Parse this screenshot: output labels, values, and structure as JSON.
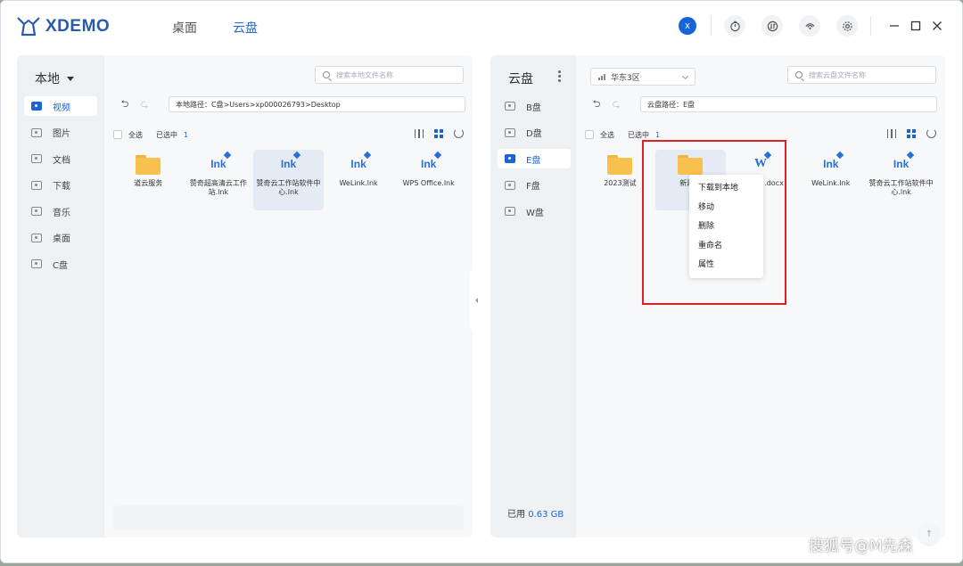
{
  "app": {
    "logo_text": "XDEMO"
  },
  "nav": {
    "tabs": [
      {
        "label": "桌面"
      },
      {
        "label": "云盘"
      }
    ],
    "active": 1
  },
  "titlebar": {
    "avatar_letter": "x"
  },
  "left": {
    "title": "本地",
    "sidebar": [
      {
        "label": "视频",
        "active": true
      },
      {
        "label": "图片"
      },
      {
        "label": "文档"
      },
      {
        "label": "下载"
      },
      {
        "label": "音乐"
      },
      {
        "label": "桌面"
      },
      {
        "label": "C盘"
      }
    ],
    "search_placeholder": "搜索本地文件名称",
    "path": "本地路径：C盘>Users>xp000026793>Desktop",
    "select_all": "全选",
    "selected_label": "已选中",
    "selected_count": "1",
    "files": [
      {
        "type": "folder",
        "name": "道云服务"
      },
      {
        "type": "lnk",
        "icon_text": "Ink",
        "name": "赞奇超高清云工作站.lnk"
      },
      {
        "type": "lnk",
        "icon_text": "Ink",
        "name": "赞奇云工作站软件中心.lnk",
        "selected": true
      },
      {
        "type": "lnk",
        "icon_text": "Ink",
        "name": "WeLink.lnk"
      },
      {
        "type": "lnk",
        "icon_text": "Ink",
        "name": "WPS Office.lnk"
      }
    ]
  },
  "right": {
    "title": "云盘",
    "sidebar": [
      {
        "label": "B盘"
      },
      {
        "label": "D盘"
      },
      {
        "label": "E盘",
        "active": true
      },
      {
        "label": "F盘"
      },
      {
        "label": "W盘"
      }
    ],
    "region": "华东3区",
    "search_placeholder": "搜索云盘文件名称",
    "path": "云盘路径：E盘",
    "select_all": "全选",
    "selected_label": "已选中",
    "selected_count": "1",
    "usage_label": "已用",
    "usage_value": "0.63 GB",
    "files": [
      {
        "type": "folder",
        "name": "2023测试"
      },
      {
        "type": "folder",
        "name": "新建文",
        "selected": true
      },
      {
        "type": "docx",
        "icon_text": "W",
        "name": ".docx"
      },
      {
        "type": "lnk",
        "icon_text": "Ink",
        "name": "WeLink.lnk"
      },
      {
        "type": "lnk",
        "icon_text": "Ink",
        "name": "赞奇云工作站软件中心.lnk"
      }
    ]
  },
  "context_menu": {
    "items": [
      "下载到本地",
      "移动",
      "删除",
      "重命名",
      "属性"
    ]
  },
  "fab_label": "↑",
  "watermark": "搜狐号@M先森",
  "colors": {
    "accent": "#1b63d6",
    "highlight": "#e02020",
    "folder": "#f8c04c"
  }
}
